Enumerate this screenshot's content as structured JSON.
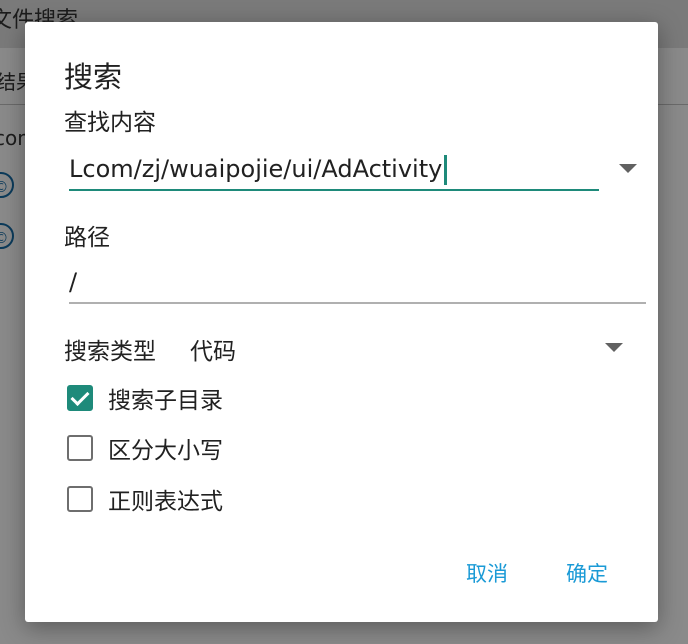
{
  "background": {
    "title": "文件搜索",
    "results_label": "结果(2)",
    "item_text": "com"
  },
  "dialog": {
    "title": "搜索",
    "find_label": "查找内容",
    "find_value": "Lcom/zj/wuaipojie/ui/AdActivity",
    "path_label": "路径",
    "path_value": "/",
    "search_type_label": "搜索类型",
    "search_type_value": "代码",
    "options": [
      {
        "label": "搜索子目录",
        "checked": true
      },
      {
        "label": "区分大小写",
        "checked": false
      },
      {
        "label": "正则表达式",
        "checked": false
      }
    ],
    "cancel_label": "取消",
    "ok_label": "确定"
  },
  "colors": {
    "accent": "#1e8a7a",
    "button_text": "#1a9ad6",
    "dim_background": "#8a8a8a"
  },
  "icons": {
    "dropdown": "triangle-down-icon",
    "check": "checkmark-icon"
  }
}
